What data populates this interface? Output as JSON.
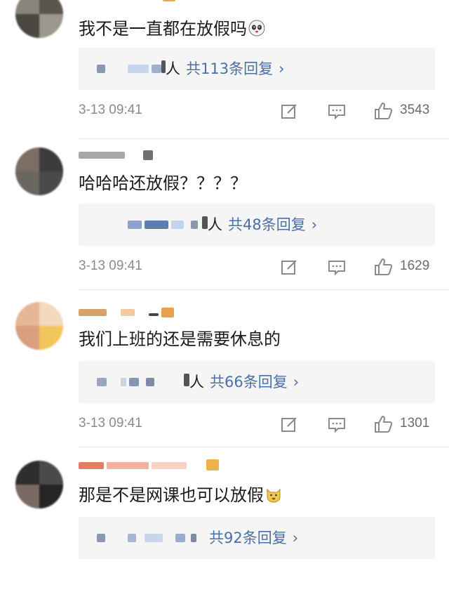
{
  "comments": [
    {
      "text": "我不是一直都在放假吗",
      "emoji": "panda-face-emoji",
      "reply_ren": "人",
      "reply_count": "共113条回复",
      "reply_arrow": "›",
      "date": "3-13 09:41",
      "likes": "3543"
    },
    {
      "text": "哈哈哈还放假？？？？",
      "emoji": "",
      "reply_ren": "人",
      "reply_count": "共48条回复",
      "reply_arrow": "›",
      "date": "3-13 09:41",
      "likes": "1629"
    },
    {
      "text": "我们上班的还是需要休息的",
      "emoji": "",
      "reply_ren": "人",
      "reply_count": "共66条回复",
      "reply_arrow": "›",
      "date": "3-13 09:41",
      "likes": "1301"
    },
    {
      "text": "那是不是网课也可以放假",
      "emoji": "doge-emoji",
      "reply_ren": "",
      "reply_count": "共92条回复",
      "reply_arrow": "›",
      "date": "",
      "likes": ""
    }
  ],
  "icons": {
    "repost": "edit-repost-icon",
    "comment": "comment-icon",
    "like": "thumbs-up-icon"
  },
  "colors": {
    "link": "#4a6fa5",
    "meta": "#8a8a8a",
    "reply_bg": "#f5f5f5"
  }
}
